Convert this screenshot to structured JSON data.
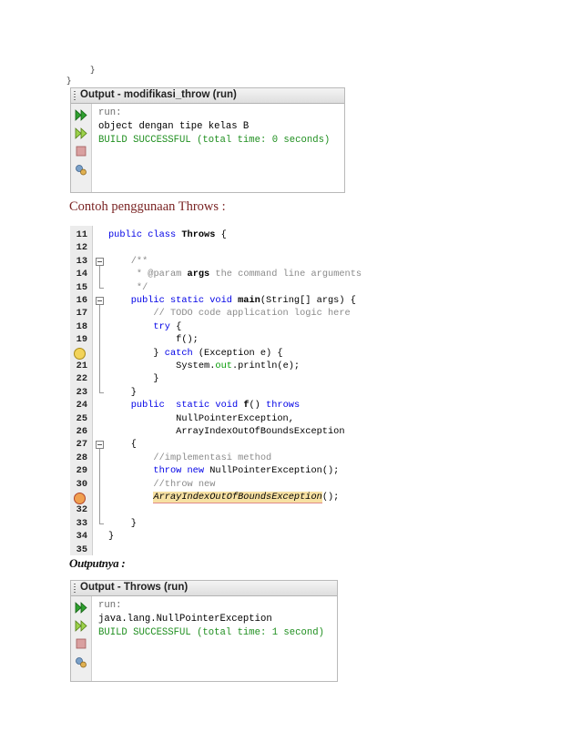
{
  "stray_marks": {
    "brace_a": "}",
    "brace_b": "}"
  },
  "panel1": {
    "title": "Output - modifikasi_throw (run)",
    "lines": [
      {
        "text": "run:",
        "color": "grey"
      },
      {
        "text": "object dengan tipe kelas B",
        "color": "black"
      },
      {
        "text": "BUILD SUCCESSFUL (total time: 0 seconds)",
        "color": "green"
      }
    ]
  },
  "heading": "Contoh penggunaan Throws :",
  "code": {
    "line_numbers": [
      "11",
      "12",
      "13",
      "14",
      "15",
      "16",
      "17",
      "18",
      "19",
      "",
      "21",
      "22",
      "23",
      "24",
      "25",
      "26",
      "27",
      "28",
      "29",
      "30",
      "",
      "32",
      "33",
      "34",
      "35"
    ],
    "lines": [
      [
        {
          "t": "public class ",
          "c": "kw"
        },
        {
          "t": "Throws",
          "c": "bold"
        },
        {
          "t": " {",
          "c": ""
        }
      ],
      [],
      [
        {
          "t": "    /**",
          "c": "cm"
        }
      ],
      [
        {
          "t": "     * ",
          "c": "cm"
        },
        {
          "t": "@param",
          "c": "cm"
        },
        {
          "t": " args",
          "c": "bold"
        },
        {
          "t": " the command line arguments",
          "c": "cm"
        }
      ],
      [
        {
          "t": "     */",
          "c": "cm"
        }
      ],
      [
        {
          "t": "    public static void ",
          "c": "kw"
        },
        {
          "t": "main",
          "c": "bold"
        },
        {
          "t": "(String[] args) {",
          "c": ""
        }
      ],
      [
        {
          "t": "        // TODO code application logic here",
          "c": "cm"
        }
      ],
      [
        {
          "t": "        try",
          "c": "kw"
        },
        {
          "t": " {",
          "c": ""
        }
      ],
      [
        {
          "t": "            f();",
          "c": ""
        }
      ],
      [
        {
          "t": "        } ",
          "c": ""
        },
        {
          "t": "catch",
          "c": "kw"
        },
        {
          "t": " (Exception e) {",
          "c": ""
        }
      ],
      [
        {
          "t": "            System.",
          "c": ""
        },
        {
          "t": "out",
          "c": "grn"
        },
        {
          "t": ".println(e);",
          "c": ""
        }
      ],
      [
        {
          "t": "        }",
          "c": ""
        }
      ],
      [
        {
          "t": "    }",
          "c": ""
        }
      ],
      [
        {
          "t": "    public  static void ",
          "c": "kw"
        },
        {
          "t": "f",
          "c": "bold"
        },
        {
          "t": "() ",
          "c": ""
        },
        {
          "t": "throws",
          "c": "kw"
        }
      ],
      [
        {
          "t": "            NullPointerException,",
          "c": ""
        }
      ],
      [
        {
          "t": "            ArrayIndexOutOfBoundsException",
          "c": ""
        }
      ],
      [
        {
          "t": "    {",
          "c": ""
        }
      ],
      [
        {
          "t": "        //implementasi method",
          "c": "cm"
        }
      ],
      [
        {
          "t": "        throw new ",
          "c": "kw"
        },
        {
          "t": "NullPointerException();",
          "c": ""
        }
      ],
      [
        {
          "t": "        //throw new",
          "c": "cm"
        }
      ],
      [
        {
          "t": "        ",
          "c": ""
        },
        {
          "t": "ArrayIndexOutOfBoundsException",
          "c": "hl"
        },
        {
          "t": "();",
          "c": ""
        }
      ],
      [],
      [
        {
          "t": "    }",
          "c": ""
        }
      ],
      [
        {
          "t": "}",
          "c": ""
        }
      ],
      []
    ]
  },
  "output_label": "Outputnya :",
  "panel2": {
    "title": "Output - Throws (run)",
    "lines": [
      {
        "text": "run:",
        "color": "grey"
      },
      {
        "text": "java.lang.NullPointerException",
        "color": "black"
      },
      {
        "text": "BUILD SUCCESSFUL (total time: 1 second)",
        "color": "green"
      }
    ]
  }
}
